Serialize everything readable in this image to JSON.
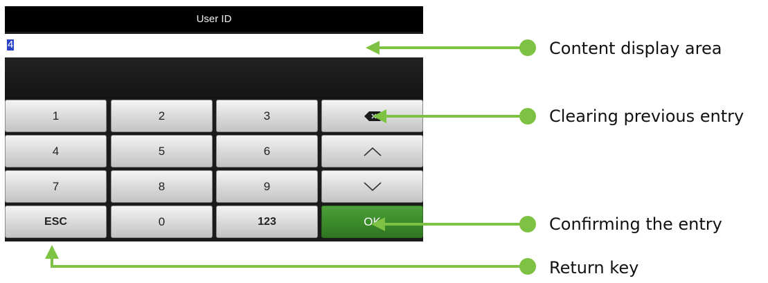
{
  "device": {
    "title": "User ID",
    "display_value": "4"
  },
  "keypad": {
    "row1": [
      "1",
      "2",
      "3"
    ],
    "row2": [
      "4",
      "5",
      "6"
    ],
    "row3": [
      "7",
      "8",
      "9"
    ],
    "esc_label": "ESC",
    "zero_label": "0",
    "mode_label": "123",
    "ok_label": "OK",
    "backspace_icon": "backspace-icon",
    "up_icon": "chevron-up-icon",
    "down_icon": "chevron-down-icon"
  },
  "annotations": {
    "content_display": "Content display area",
    "clear_previous": "Clearing previous entry",
    "confirm": "Confirming the entry",
    "return": "Return key"
  },
  "colors": {
    "arrow_green": "#7dc242",
    "ok_green": "#3b8a2a",
    "selection_blue": "#2a44c8"
  }
}
